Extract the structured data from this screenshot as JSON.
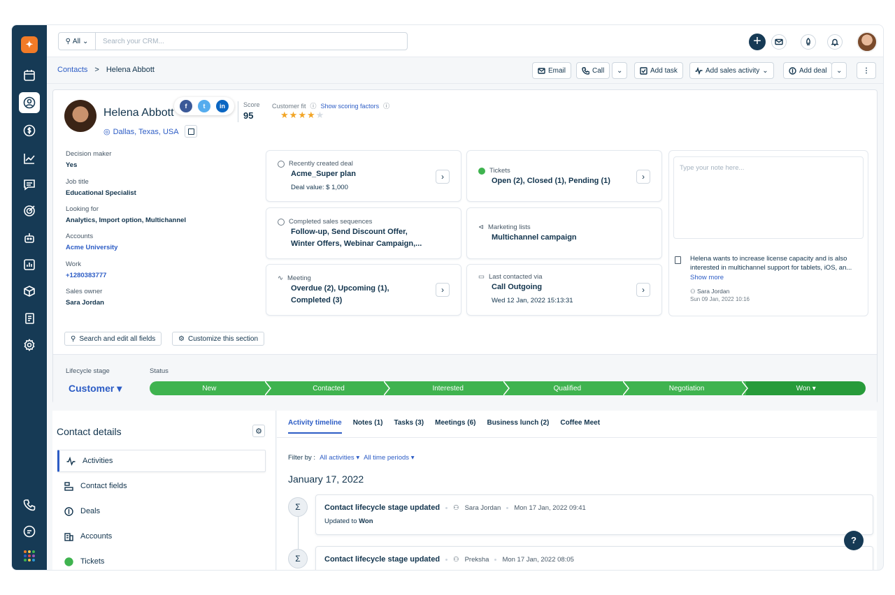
{
  "sidebar": {
    "logo": "✦",
    "icons": [
      "calendar-icon",
      "contacts-icon",
      "deals-icon",
      "analytics-icon",
      "conversations-icon",
      "goals-icon",
      "bot-icon",
      "reports-icon",
      "products-icon",
      "documents-icon",
      "settings-icon",
      "phone-icon",
      "chat-icon",
      "apps-icon"
    ]
  },
  "topbar": {
    "search_scope": "All",
    "search_placeholder": "Search your CRM..."
  },
  "breadcrumb": {
    "parent": "Contacts",
    "separator": ">",
    "current": "Helena Abbott"
  },
  "actions": {
    "email": "Email",
    "call": "Call",
    "add_task": "Add task",
    "add_sales_activity": "Add sales activity",
    "add_deal": "Add deal"
  },
  "profile": {
    "name": "Helena Abbott",
    "location": "Dallas, Texas, USA",
    "social": {
      "facebook": "f",
      "twitter": "t",
      "linkedin": "in"
    },
    "score_label": "Score",
    "score": "95",
    "customer_fit_label": "Customer fit",
    "scoring_link": "Show scoring factors",
    "fit_stars": 4,
    "fit_stars_max": 5
  },
  "fields": [
    {
      "label": "Decision maker",
      "value": "Yes"
    },
    {
      "label": "Job title",
      "value": "Educational Specialist"
    },
    {
      "label": "Looking for",
      "value": "Analytics, Import option, Multichannel"
    },
    {
      "label": "Accounts",
      "value": "Acme University"
    },
    {
      "label": "Work",
      "value": "+1280383777"
    },
    {
      "label": "Sales owner",
      "value": "Sara Jordan"
    }
  ],
  "tiles": {
    "deal": {
      "label": "Recently created deal",
      "main": "Acme_Super plan",
      "sub": "Deal value: $ 1,000"
    },
    "tickets": {
      "label": "Tickets",
      "main": "Open (2), Closed (1), Pending (1)"
    },
    "sequences": {
      "label": "Completed sales sequences",
      "main_1": "Follow-up, Send Discount Offer,",
      "main_2": "Winter Offers, Webinar Campaign,..."
    },
    "marketing": {
      "label": "Marketing lists",
      "main": "Multichannel campaign"
    },
    "meeting": {
      "label": "Meeting",
      "main_1": "Overdue (2), Upcoming (1),",
      "main_2": "Completed (3)"
    },
    "contacted": {
      "label": "Last contacted via",
      "main": "Call Outgoing",
      "sub": "Wed 12 Jan, 2022 15:13:31"
    }
  },
  "notes": {
    "placeholder": "Type your note here...",
    "text": "Helena wants to increase license capacity and is also interested in multichannel support for tablets, iOS, an...",
    "show_more": "Show more",
    "author": "Sara Jordan",
    "date": "Sun 09 Jan, 2022 10:16"
  },
  "section_buttons": {
    "search_edit": "Search and edit all fields",
    "customize": "Customize this section"
  },
  "lifecycle": {
    "stage_label": "Lifecycle stage",
    "status_label": "Status",
    "stage_value": "Customer ▾",
    "stages": [
      "New",
      "Contacted",
      "Interested",
      "Qualified",
      "Negotiation",
      "Won ▾"
    ]
  },
  "contact_details": {
    "title": "Contact details",
    "items": [
      "Activities",
      "Contact fields",
      "Deals",
      "Accounts",
      "Tickets"
    ]
  },
  "timeline": {
    "tabs": [
      "Activity timeline",
      "Notes (1)",
      "Tasks (3)",
      "Meetings (6)",
      "Business lunch (2)",
      "Coffee Meet"
    ],
    "filter_label": "Filter by :",
    "filter_activities": "All activities ▾",
    "filter_time": "All time periods ▾",
    "date_heading": "January 17, 2022",
    "entries": [
      {
        "title": "Contact lifecycle stage updated",
        "user": "Sara Jordan",
        "time": "Mon 17 Jan, 2022 09:41",
        "body_prefix": "Updated to",
        "body_value": "Won"
      },
      {
        "title": "Contact lifecycle stage updated",
        "user": "Preksha",
        "time": "Mon 17 Jan, 2022 08:05"
      }
    ]
  },
  "help_label": "?",
  "colors": {
    "sidebar": "#163a55",
    "accent": "#2c5cc5",
    "stage_green": "#3fb34f",
    "stage_won": "#279b3a",
    "logo": "#f27b27"
  }
}
